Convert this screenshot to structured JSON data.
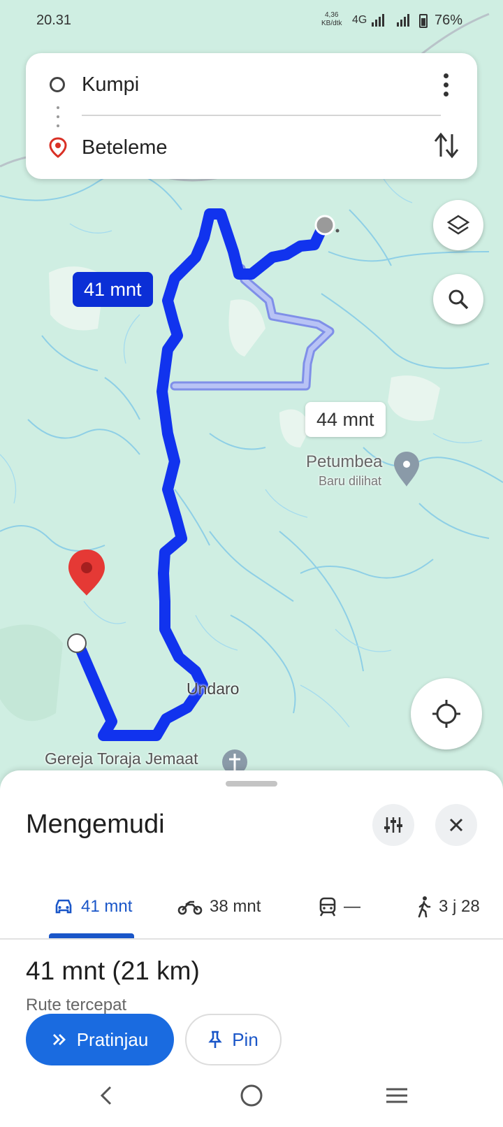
{
  "status_bar": {
    "time": "20.31",
    "net_speed_value": "4,36",
    "net_speed_unit": "KB/dtk",
    "network": "4G",
    "battery": "76%"
  },
  "search": {
    "origin": "Kumpi",
    "destination": "Beteleme"
  },
  "map": {
    "route_main_time": "41 mnt",
    "route_alt_time": "44 mnt",
    "place_name": "Petumbea",
    "place_subtitle": "Baru dilihat",
    "label_undaro": "Undaro",
    "label_church": "Gereja Toraja Jemaat",
    "colors": {
      "land": "#cfeee2",
      "water": "#8ecfe6",
      "main_route": "#1133ee",
      "alt_route": "#a9b6f2",
      "pin": "#e53935"
    }
  },
  "sheet": {
    "title": "Mengemudi",
    "modes": [
      {
        "icon": "car-icon",
        "label": "41 mnt",
        "active": true
      },
      {
        "icon": "motorcycle-icon",
        "label": "38 mnt",
        "active": false
      },
      {
        "icon": "transit-icon",
        "label": "—",
        "active": false
      },
      {
        "icon": "walk-icon",
        "label": "3 j 28",
        "active": false
      }
    ],
    "summary": "41 mnt (21 km)",
    "subtitle": "Rute tercepat",
    "preview_label": "Pratinjau",
    "pin_label": "Pin"
  }
}
